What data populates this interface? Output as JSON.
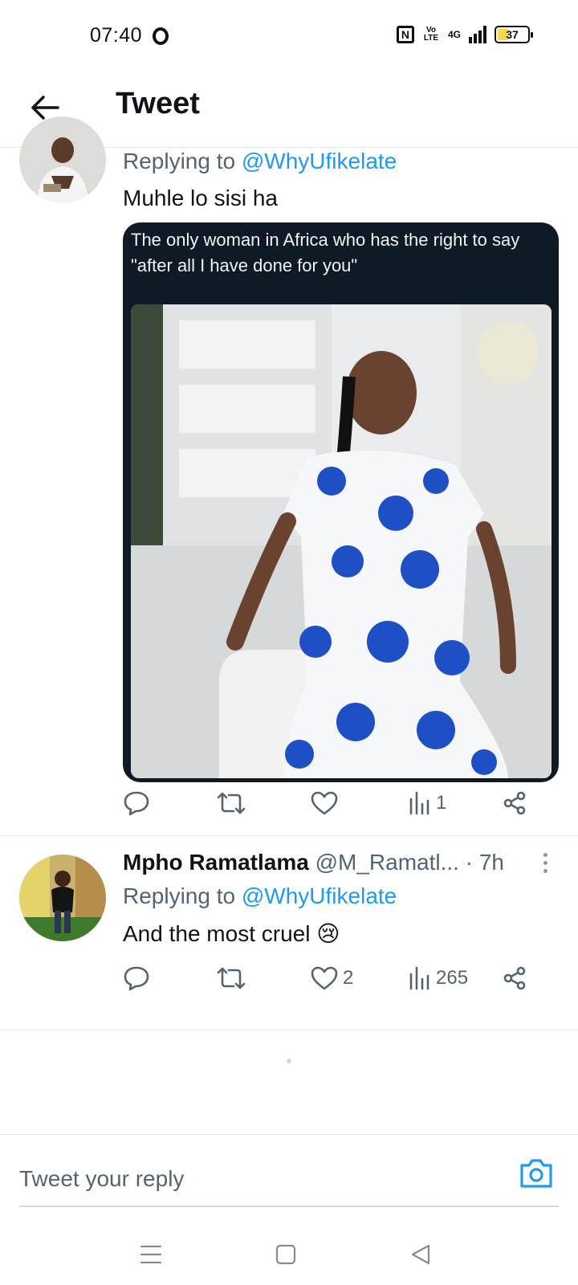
{
  "status_bar": {
    "time": "07:40",
    "network": "4G",
    "battery": "37"
  },
  "header": {
    "title": "Tweet"
  },
  "tweet1": {
    "replying_prefix": "Replying to",
    "replying_handle": "@WhyUfikelate",
    "text": "Muhle lo sisi ha",
    "media_caption": "The only woman in Africa who has the right to say \"after all I have done for you\"",
    "views": "1"
  },
  "tweet2": {
    "author_name": "Mpho Ramatlama",
    "author_handle": "@M_Ramatl...",
    "time": "· 7h",
    "replying_prefix": "Replying to",
    "replying_handle": "@WhyUfikelate",
    "text": "And the most cruel 😢",
    "likes": "2",
    "views": "265"
  },
  "reply_bar": {
    "placeholder": "Tweet your reply"
  },
  "colors": {
    "accent": "#1d9bf0",
    "muted": "#536471",
    "text": "#0f1419"
  }
}
